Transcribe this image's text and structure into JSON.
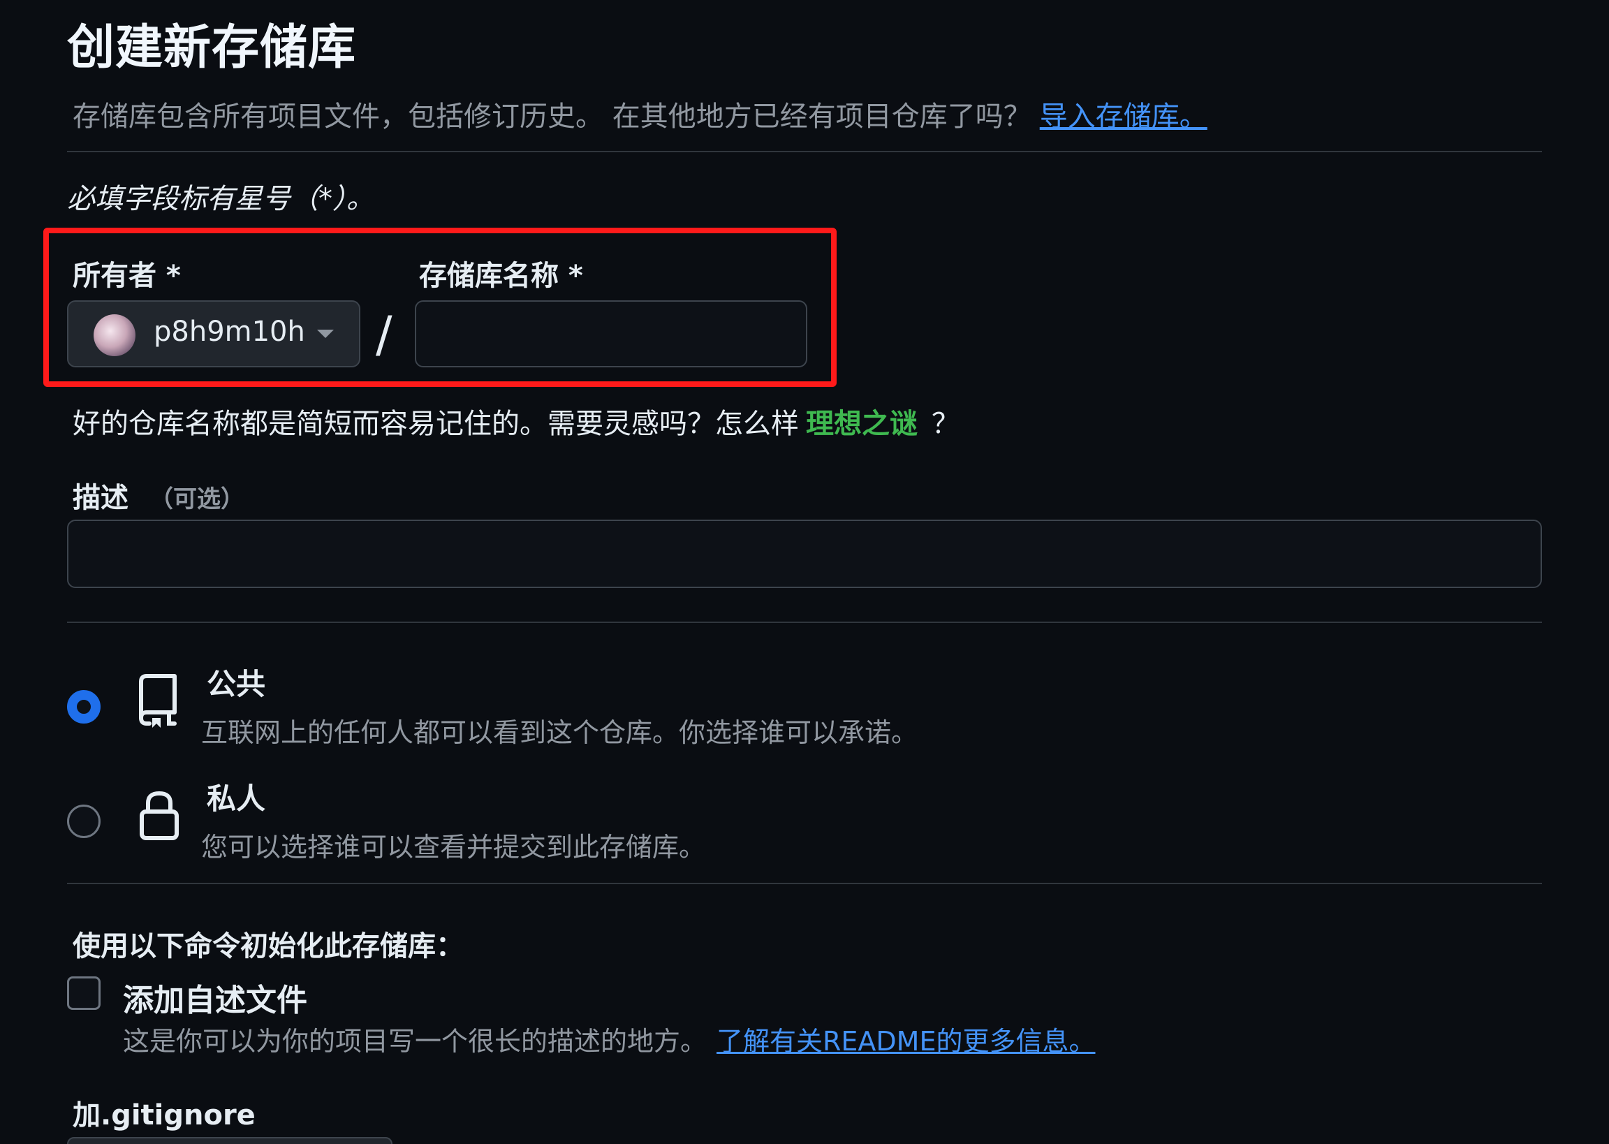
{
  "page": {
    "title": "创建新存储库",
    "subtitle": "存储库包含所有项目文件，包括修订历史。 在其他地方已经有项目仓库了吗？",
    "import_link": "导入存储库。",
    "required_note": "必填字段标有星号（*）。"
  },
  "owner": {
    "label": "所有者 *",
    "value": "p8h9m10h"
  },
  "separator": "/",
  "repo_name": {
    "label": "存储库名称 *",
    "value": ""
  },
  "hint": {
    "text": "好的仓库名称都是简短而容易记住的。需要灵感吗？怎么样",
    "suggestion": "理想之谜",
    "suffix": "？"
  },
  "description": {
    "label": "描述",
    "optional": "（可选）",
    "value": ""
  },
  "visibility": {
    "selected": "public",
    "public": {
      "title": "公共",
      "desc": "互联网上的任何人都可以看到这个仓库。你选择谁可以承诺。"
    },
    "private": {
      "title": "私人",
      "desc": "您可以选择谁可以查看并提交到此存储库。"
    }
  },
  "init": {
    "heading": "使用以下命令初始化此存储库：",
    "readme_title": "添加自述文件",
    "readme_desc": "这是你可以为你的项目写一个很长的描述的地方。",
    "readme_link": "了解有关README的更多信息。",
    "readme_checked": false,
    "gitignore_label": "加.gitignore"
  },
  "colors": {
    "background": "#0a0d12",
    "accent_blue": "#1f6feb",
    "link_blue": "#4493f8",
    "suggestion_green": "#3fb950",
    "highlight_red": "#ff1a1a"
  }
}
